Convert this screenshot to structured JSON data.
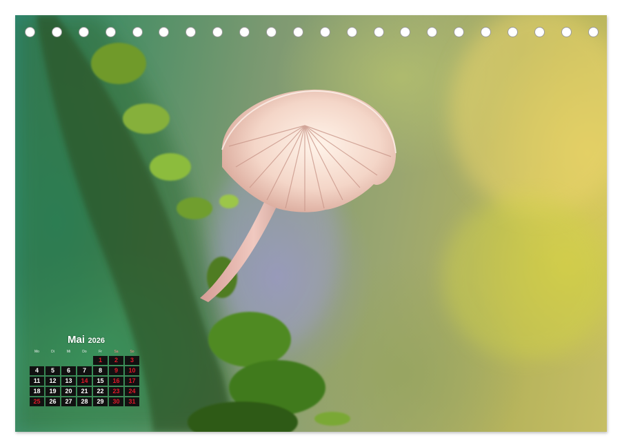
{
  "calendar": {
    "month": "Mai",
    "year": "2026",
    "weekdays": [
      "Mo",
      "Di",
      "Mi",
      "Do",
      "Fr",
      "Sa",
      "So"
    ],
    "weekend_color": "#e2192a",
    "weeks": [
      [
        "",
        "",
        "",
        "",
        "1",
        "2",
        "3"
      ],
      [
        "4",
        "5",
        "6",
        "7",
        "8",
        "9",
        "10"
      ],
      [
        "11",
        "12",
        "13",
        "14",
        "15",
        "16",
        "17"
      ],
      [
        "18",
        "19",
        "20",
        "21",
        "22",
        "23",
        "24"
      ],
      [
        "25",
        "26",
        "27",
        "28",
        "29",
        "30",
        "31"
      ]
    ],
    "highlighted_days": [
      "1",
      "14",
      "25"
    ]
  },
  "binding": {
    "hole_count": 22
  },
  "photo": {
    "subject": "mushroom-with-moss"
  }
}
